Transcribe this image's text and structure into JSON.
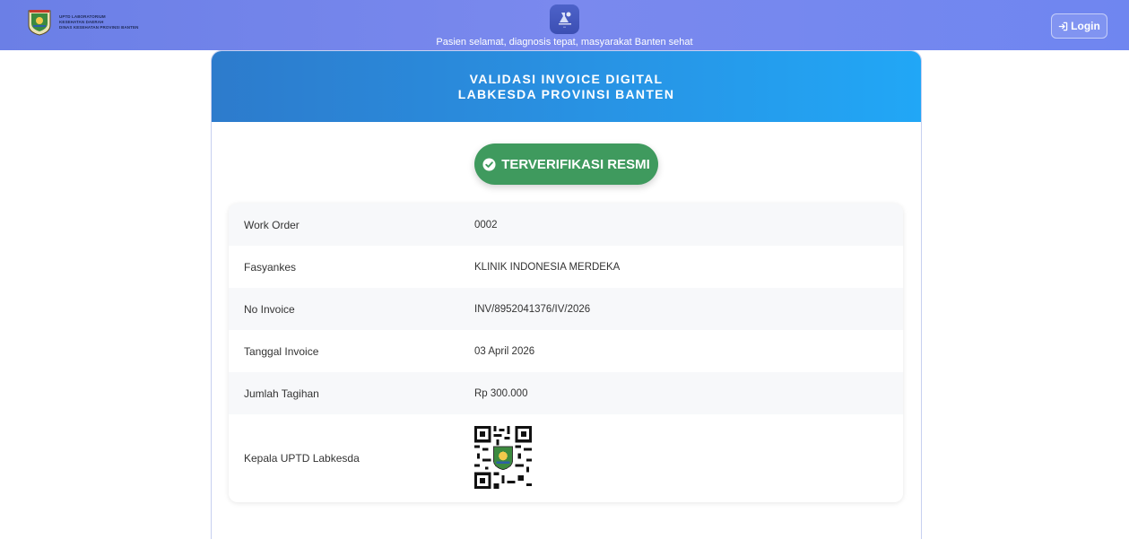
{
  "header": {
    "brand_lines": [
      "UPTD LABORATORIUM",
      "KESEHATAN DAERAH",
      "DINAS KESEHATAN PROVINSI BANTEN"
    ],
    "brand_logo_icon": "banten-emblem-icon",
    "center_logo_icon": "labkesda-logo-icon",
    "tagline": "Pasien selamat, diagnosis tepat, masyarakat Banten sehat",
    "login_label": "Login",
    "login_icon": "sign-in-icon"
  },
  "card": {
    "title_line1": "VALIDASI INVOICE DIGITAL",
    "title_line2": "LABKESDA PROVINSI BANTEN",
    "badge_label": "TERVERIFIKASI RESMI",
    "badge_icon": "check-circle-icon",
    "rows": [
      {
        "label": "Work Order",
        "value": "0002"
      },
      {
        "label": "Fasyankes",
        "value": "KLINIK INDONESIA MERDEKA"
      },
      {
        "label": "No Invoice",
        "value": "INV/8952041376/IV/2026"
      },
      {
        "label": "Tanggal Invoice",
        "value": "03 April 2026"
      },
      {
        "label": "Jumlah Tagihan",
        "value": "Rp 300.000"
      },
      {
        "label": "Kepala UPTD Labkesda",
        "value": ""
      }
    ],
    "signature_icon": "qr-code-icon"
  },
  "colors": {
    "topbar": "#7a89ee",
    "header_gradient_start": "#2d7bcc",
    "header_gradient_end": "#21a7f6",
    "verified_green": "#3f9a5e"
  }
}
